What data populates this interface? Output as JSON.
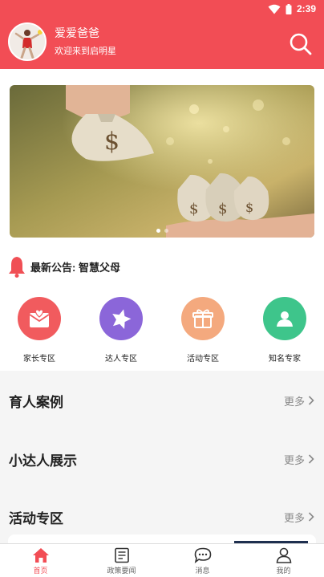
{
  "status_bar": {
    "time": "2:39"
  },
  "header": {
    "username": "爱爱爸爸",
    "welcome": "欢迎来到启明星"
  },
  "banner": {
    "slide_count": 2,
    "active_index": 0
  },
  "notice": {
    "text": "最新公告: 智慧父母"
  },
  "categories": [
    {
      "label": "家长专区",
      "icon": "envelope-heart-icon",
      "color": "#f05a5a"
    },
    {
      "label": "达人专区",
      "icon": "star-icon",
      "color": "#8a63d8"
    },
    {
      "label": "活动专区",
      "icon": "gift-icon",
      "color": "#f2a77a"
    },
    {
      "label": "知名专家",
      "icon": "user-card-icon",
      "color": "#3cc38a"
    }
  ],
  "sections": [
    {
      "title": "育人案例",
      "more": "更多"
    },
    {
      "title": "小达人展示",
      "more": "更多"
    },
    {
      "title": "活动专区",
      "more": "更多"
    }
  ],
  "tabbar": {
    "active": 0,
    "tabs": [
      {
        "label": "首页",
        "icon": "home-icon"
      },
      {
        "label": "政策要闻",
        "icon": "news-icon"
      },
      {
        "label": "消息",
        "icon": "chat-icon"
      },
      {
        "label": "我的",
        "icon": "profile-icon"
      }
    ]
  },
  "colors": {
    "brand": "#f24d55",
    "active_tab": "#f24d55"
  }
}
